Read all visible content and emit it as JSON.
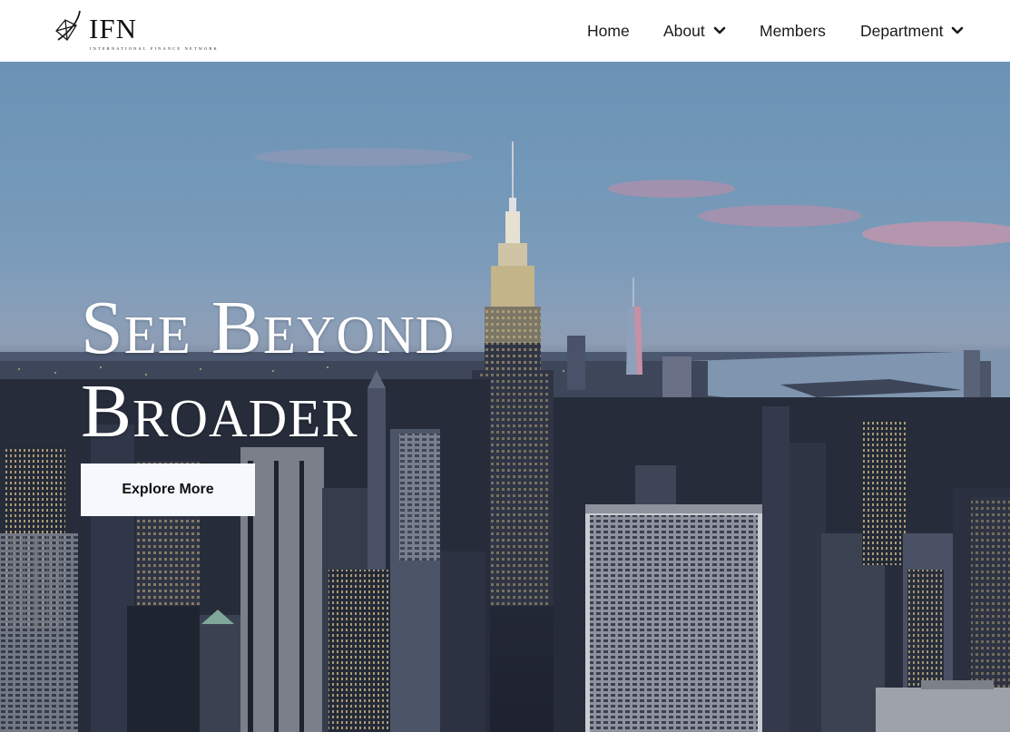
{
  "brand": {
    "name": "IFN",
    "tagline": "INTERNATIONAL FINANCE NETWORK"
  },
  "nav": {
    "home": "Home",
    "about": "About",
    "members": "Members",
    "department": "Department"
  },
  "hero": {
    "title_line1": "See Beyond",
    "title_line2": "Broader",
    "button_label": "Explore More"
  },
  "colors": {
    "accent": "#f5f8fd",
    "nav_text": "#1a1a1a"
  }
}
